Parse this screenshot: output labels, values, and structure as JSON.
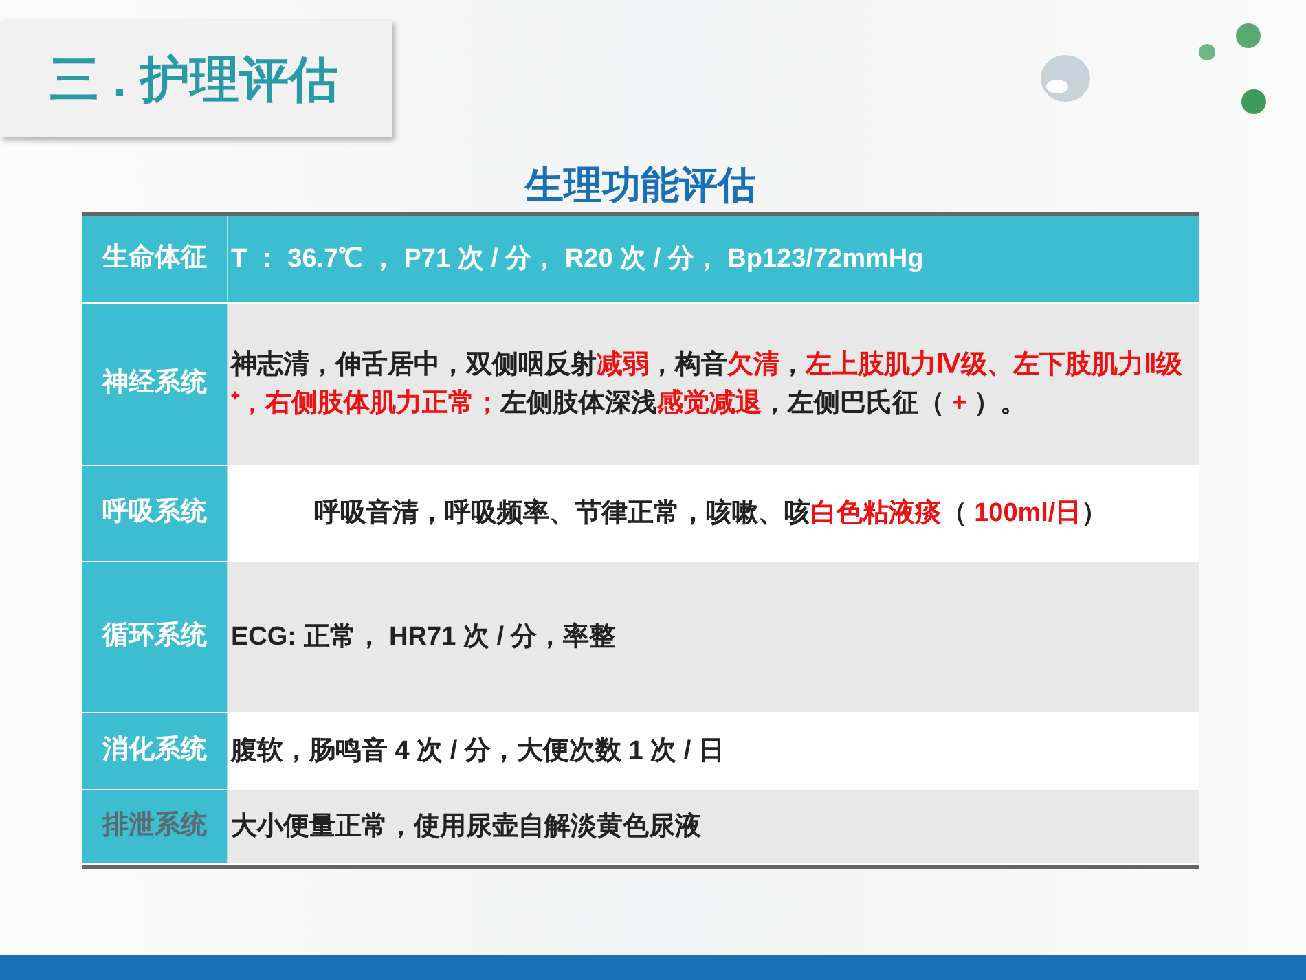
{
  "slide_title": "三 . 护理评估",
  "table": {
    "caption": "生理功能评估",
    "rows": [
      {
        "label": "生命体征",
        "dim": false,
        "header": true,
        "segments": [
          {
            "text": "T ： 36.7℃ ， P71 次 / 分， R20 次 / 分， Bp123/72mmHg",
            "emphasis": false
          }
        ]
      },
      {
        "label": "神经系统",
        "dim": false,
        "header": false,
        "segments": [
          {
            "text": "神志清，伸舌居中，双侧咽反射",
            "emphasis": false
          },
          {
            "text": "减弱",
            "emphasis": true
          },
          {
            "text": "，构音",
            "emphasis": false
          },
          {
            "text": "欠清",
            "emphasis": true
          },
          {
            "text": "，",
            "emphasis": false
          },
          {
            "text": "左上肢肌力Ⅳ级、左下肢肌力Ⅱ级⁺，右侧肢体肌力正常；",
            "emphasis": true
          },
          {
            "text": "左侧肢体深浅",
            "emphasis": false
          },
          {
            "text": "感觉减退",
            "emphasis": true
          },
          {
            "text": "，左侧巴氏征（ ",
            "emphasis": false
          },
          {
            "text": "+",
            "emphasis": true
          },
          {
            "text": " ）。",
            "emphasis": false
          }
        ]
      },
      {
        "label": "呼吸系统",
        "dim": false,
        "header": false,
        "segments": [
          {
            "text": "呼吸音清，呼吸频率、节律正常，咳嗽、咳",
            "emphasis": false
          },
          {
            "text": "白色粘液痰",
            "emphasis": true
          },
          {
            "text": "（ ",
            "emphasis": false
          },
          {
            "text": "100ml/日",
            "emphasis": true
          },
          {
            "text": "）",
            "emphasis": false
          }
        ]
      },
      {
        "label": "循环系统",
        "dim": false,
        "header": false,
        "segments": [
          {
            "text": "ECG: 正常， HR71 次 / 分，率整",
            "emphasis": false
          }
        ]
      },
      {
        "label": "消化系统",
        "dim": false,
        "header": false,
        "segments": [
          {
            "text": "腹软，肠鸣音 4 次 / 分，大便次数 1 次 / 日",
            "emphasis": false
          }
        ]
      },
      {
        "label": "排泄系统",
        "dim": true,
        "header": false,
        "segments": [
          {
            "text": "大小便量正常，使用尿壶自解淡黄色尿液",
            "emphasis": false
          }
        ]
      }
    ]
  }
}
